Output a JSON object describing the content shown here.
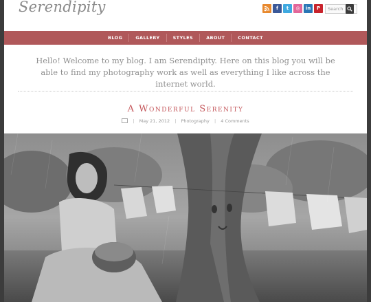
{
  "site": {
    "logo_text": "Serendipity"
  },
  "social": [
    {
      "icon": "rss-icon",
      "glyph": "",
      "color": "#e8892e"
    },
    {
      "icon": "facebook-icon",
      "glyph": "f",
      "color": "#3b5998"
    },
    {
      "icon": "twitter-icon",
      "glyph": "t",
      "color": "#3fa9e0"
    },
    {
      "icon": "dribbble-icon",
      "glyph": "◎",
      "color": "#e2679a"
    },
    {
      "icon": "linkedin-icon",
      "glyph": "in",
      "color": "#2a76b5"
    },
    {
      "icon": "pinterest-icon",
      "glyph": "P",
      "color": "#c8232c"
    }
  ],
  "search": {
    "placeholder": "Search"
  },
  "nav": {
    "items": [
      "Blog",
      "Gallery",
      "Styles",
      "About",
      "Contact"
    ]
  },
  "welcome": {
    "text": "Hello! Welcome to my blog. I am Serendipity. Here on this blog you will be able to find my photography work as well as everything I like across the internet world."
  },
  "post": {
    "title": "A Wonderful Serenity",
    "date": "May 21, 2012",
    "category": "Photography",
    "comments": "4 Comments"
  },
  "colors": {
    "accent": "#b0585a",
    "title": "#c4565a",
    "background": "#3c3c3c"
  }
}
